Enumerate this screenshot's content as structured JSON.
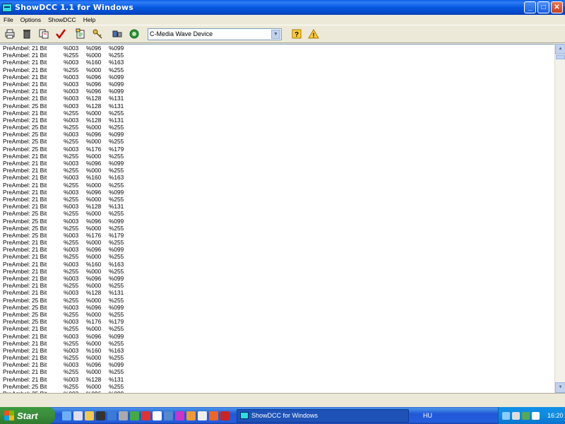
{
  "window": {
    "title": "ShowDCC 1.1 for Windows"
  },
  "menu": [
    "File",
    "Options",
    "ShowDCC",
    "Help"
  ],
  "toolbar": {
    "tools": [
      "print-icon",
      "trash-icon",
      "copy-icon",
      "check-icon",
      "export-icon",
      "key-icon",
      "connect-icon",
      "record-icon"
    ],
    "device_select": "C-Media Wave Device",
    "help_icon": "help-icon",
    "about_icon": "warning-icon"
  },
  "rows": [
    [
      "PreAmbel: 21 Bit",
      "%003",
      "%096",
      "%099"
    ],
    [
      "PreAmbel: 21 Bit",
      "%255",
      "%000",
      "%255"
    ],
    [
      "PreAmbel: 21 Bit",
      "%003",
      "%160",
      "%163"
    ],
    [
      "PreAmbel: 21 Bit",
      "%255",
      "%000",
      "%255"
    ],
    [
      "PreAmbel: 21 Bit",
      "%003",
      "%096",
      "%099"
    ],
    [
      "PreAmbel: 21 Bit",
      "%003",
      "%096",
      "%099"
    ],
    [
      "PreAmbel: 21 Bit",
      "%003",
      "%096",
      "%099"
    ],
    [
      "PreAmbel: 21 Bit",
      "%003",
      "%128",
      "%131"
    ],
    [
      "PreAmbel: 25 Bit",
      "%003",
      "%128",
      "%131"
    ],
    [
      "PreAmbel: 21 Bit",
      "%255",
      "%000",
      "%255"
    ],
    [
      "PreAmbel: 21 Bit",
      "%003",
      "%128",
      "%131"
    ],
    [
      "PreAmbel: 25 Bit",
      "%255",
      "%000",
      "%255"
    ],
    [
      "PreAmbel: 25 Bit",
      "%003",
      "%096",
      "%099"
    ],
    [
      "PreAmbel: 25 Bit",
      "%255",
      "%000",
      "%255"
    ],
    [
      "PreAmbel: 25 Bit",
      "%003",
      "%176",
      "%179"
    ],
    [
      "PreAmbel: 21 Bit",
      "%255",
      "%000",
      "%255"
    ],
    [
      "PreAmbel: 21 Bit",
      "%003",
      "%096",
      "%099"
    ],
    [
      "PreAmbel: 21 Bit",
      "%255",
      "%000",
      "%255"
    ],
    [
      "PreAmbel: 21 Bit",
      "%003",
      "%160",
      "%163"
    ],
    [
      "PreAmbel: 21 Bit",
      "%255",
      "%000",
      "%255"
    ],
    [
      "PreAmbel: 21 Bit",
      "%003",
      "%096",
      "%099"
    ],
    [
      "PreAmbel: 21 Bit",
      "%255",
      "%000",
      "%255"
    ],
    [
      "PreAmbel: 21 Bit",
      "%003",
      "%128",
      "%131"
    ],
    [
      "PreAmbel: 25 Bit",
      "%255",
      "%000",
      "%255"
    ],
    [
      "PreAmbel: 25 Bit",
      "%003",
      "%096",
      "%099"
    ],
    [
      "PreAmbel: 25 Bit",
      "%255",
      "%000",
      "%255"
    ],
    [
      "PreAmbel: 25 Bit",
      "%003",
      "%176",
      "%179"
    ],
    [
      "PreAmbel: 21 Bit",
      "%255",
      "%000",
      "%255"
    ],
    [
      "PreAmbel: 21 Bit",
      "%003",
      "%096",
      "%099"
    ],
    [
      "PreAmbel: 21 Bit",
      "%255",
      "%000",
      "%255"
    ],
    [
      "PreAmbel: 21 Bit",
      "%003",
      "%160",
      "%163"
    ],
    [
      "PreAmbel: 21 Bit",
      "%255",
      "%000",
      "%255"
    ],
    [
      "PreAmbel: 21 Bit",
      "%003",
      "%096",
      "%099"
    ],
    [
      "PreAmbel: 21 Bit",
      "%255",
      "%000",
      "%255"
    ],
    [
      "PreAmbel: 21 Bit",
      "%003",
      "%128",
      "%131"
    ],
    [
      "PreAmbel: 25 Bit",
      "%255",
      "%000",
      "%255"
    ],
    [
      "PreAmbel: 25 Bit",
      "%003",
      "%096",
      "%099"
    ],
    [
      "PreAmbel: 25 Bit",
      "%255",
      "%000",
      "%255"
    ],
    [
      "PreAmbel: 25 Bit",
      "%003",
      "%176",
      "%179"
    ],
    [
      "PreAmbel: 21 Bit",
      "%255",
      "%000",
      "%255"
    ],
    [
      "PreAmbel: 21 Bit",
      "%003",
      "%096",
      "%099"
    ],
    [
      "PreAmbel: 21 Bit",
      "%255",
      "%000",
      "%255"
    ],
    [
      "PreAmbel: 21 Bit",
      "%003",
      "%160",
      "%163"
    ],
    [
      "PreAmbel: 21 Bit",
      "%255",
      "%000",
      "%255"
    ],
    [
      "PreAmbel: 21 Bit",
      "%003",
      "%096",
      "%099"
    ],
    [
      "PreAmbel: 21 Bit",
      "%255",
      "%000",
      "%255"
    ],
    [
      "PreAmbel: 21 Bit",
      "%003",
      "%128",
      "%131"
    ],
    [
      "PreAmbel: 25 Bit",
      "%255",
      "%000",
      "%255"
    ],
    [
      "PreAmbel: 25 Bit",
      "%003",
      "%096",
      "%099"
    ],
    [
      "PreAmbel: 25 Bit",
      "%255",
      "%000",
      "%255"
    ]
  ],
  "taskbar": {
    "start_label": "Start",
    "task_label": "ShowDCC for Windows",
    "language": "HU",
    "clock": "16:20"
  }
}
